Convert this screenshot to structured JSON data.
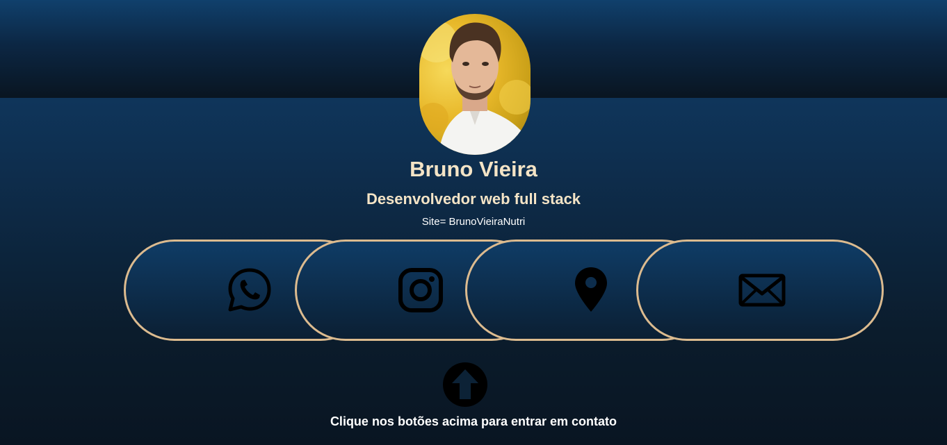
{
  "profile": {
    "name": "Bruno Vieira",
    "role": "Desenvolvedor web full stack",
    "site": "Site= BrunoVieiraNutri",
    "avatar_alt": "profile-photo"
  },
  "buttons": [
    {
      "id": "whatsapp",
      "icon": "whatsapp-icon"
    },
    {
      "id": "instagram",
      "icon": "instagram-icon"
    },
    {
      "id": "location",
      "icon": "map-pin-icon"
    },
    {
      "id": "email",
      "icon": "envelope-icon"
    }
  ],
  "footer": {
    "hint": "Clique nos botões acima para entrar em contato",
    "arrow_icon": "arrow-up-circle-icon"
  },
  "colors": {
    "accent_border": "#dcbb8f",
    "heading_text": "#f4e4c6",
    "background_top": "#11406d",
    "background_bottom": "#091522"
  }
}
